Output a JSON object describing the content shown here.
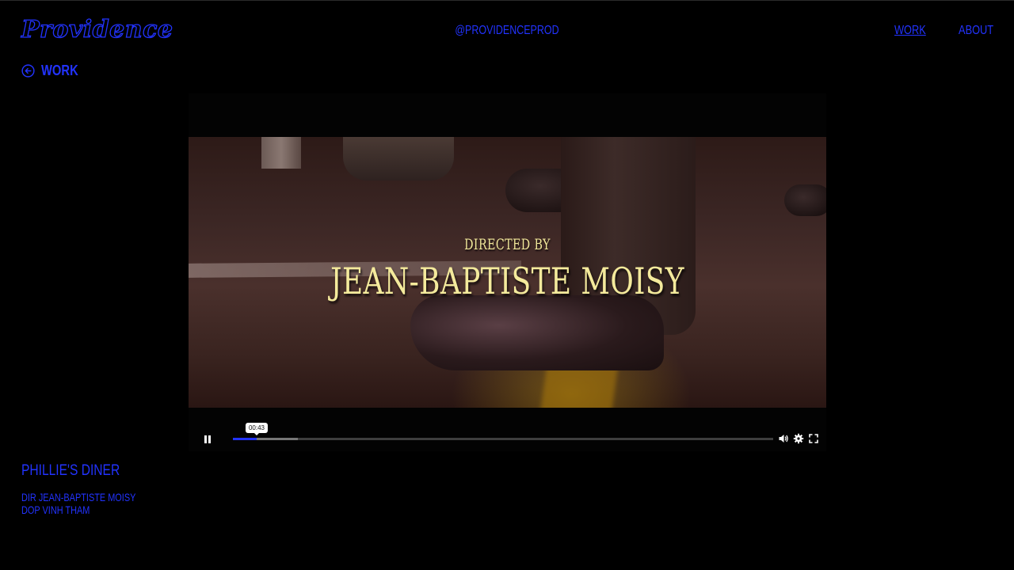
{
  "header": {
    "logo": "Providence",
    "handle": "@PROVIDENCEPROD",
    "nav": [
      {
        "label": "WORK",
        "active": true
      },
      {
        "label": "ABOUT",
        "active": false
      }
    ]
  },
  "back": {
    "label": "WORK",
    "icon": "arrow-left-circle-icon"
  },
  "video": {
    "overlay_small": "DIRECTED BY",
    "overlay_large": "JEAN-BAPTISTE MOISY",
    "state": "playing",
    "current_time": "00:43",
    "played_fraction": 0.044,
    "buffered_fraction": 0.12,
    "controls": [
      "pause-icon",
      "volume-icon",
      "gear-icon",
      "fullscreen-icon"
    ]
  },
  "project": {
    "title": "PHILLIE'S DINER",
    "credits": [
      "DIR JEAN-BAPTISTE MOISY",
      "DOP VINH THAM"
    ]
  },
  "colors": {
    "accent": "#2233ff",
    "background": "#000000",
    "credit_text": "#f4ea9c"
  }
}
